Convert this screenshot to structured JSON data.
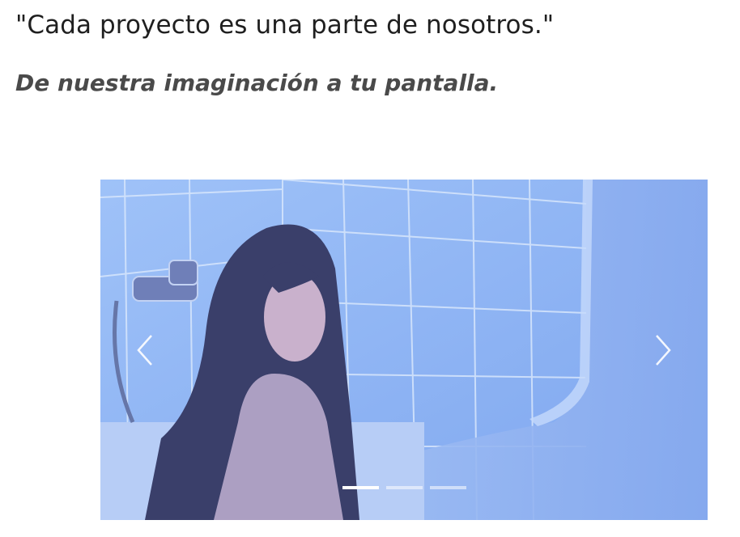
{
  "header": {
    "title": "\"Cada proyecto es una parte de nosotros.\"",
    "subtitle": "De nuestra imaginación a tu pantalla."
  },
  "carousel": {
    "slide_count": 3,
    "active_slide": 1,
    "prev_icon": "chevron-left-icon",
    "next_icon": "chevron-right-icon",
    "slide_image": "woman-in-bathtub-blue-tint-photo",
    "colors": {
      "tint": "#8fb4f4",
      "indicator_active": "#ffffff",
      "indicator_inactive": "#c9d8f8"
    }
  }
}
